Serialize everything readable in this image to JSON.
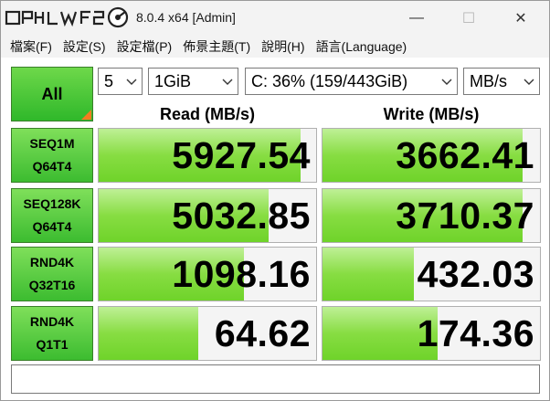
{
  "window": {
    "title": "8.0.4 x64 [Admin]",
    "logo_text": "CrystalDiskMark",
    "minimize_glyph": "—",
    "maximize_glyph": "☐",
    "close_glyph": "✕"
  },
  "menu": [
    {
      "label": "檔案(F)"
    },
    {
      "label": "設定(S)"
    },
    {
      "label": "設定檔(P)"
    },
    {
      "label": "佈景主題(T)"
    },
    {
      "label": "說明(H)"
    },
    {
      "label": "語言(Language)"
    }
  ],
  "toolbar": {
    "all_label": "All",
    "count": "5",
    "size": "1GiB",
    "drive": "C: 36% (159/443GiB)",
    "unit": "MB/s"
  },
  "columns": {
    "read": "Read (MB/s)",
    "write": "Write (MB/s)"
  },
  "rows": [
    {
      "line1": "SEQ1M",
      "line2": "Q64T4",
      "read": "5927.54",
      "write": "3662.41",
      "read_level": 0.93,
      "write_level": 0.92
    },
    {
      "line1": "SEQ128K",
      "line2": "Q64T4",
      "read": "5032.85",
      "write": "3710.37",
      "read_level": 0.78,
      "write_level": 0.92
    },
    {
      "line1": "RND4K",
      "line2": "Q32T16",
      "read": "1098.16",
      "write": "432.03",
      "read_level": 0.67,
      "write_level": 0.42
    },
    {
      "line1": "RND4K",
      "line2": "Q1T1",
      "read": "64.62",
      "write": "174.36",
      "read_level": 0.46,
      "write_level": 0.53
    }
  ],
  "comment": "",
  "colors": {
    "accent_green": "#3cbc30",
    "bar_green": "#87dd42",
    "corner_orange": "#f47b20"
  }
}
